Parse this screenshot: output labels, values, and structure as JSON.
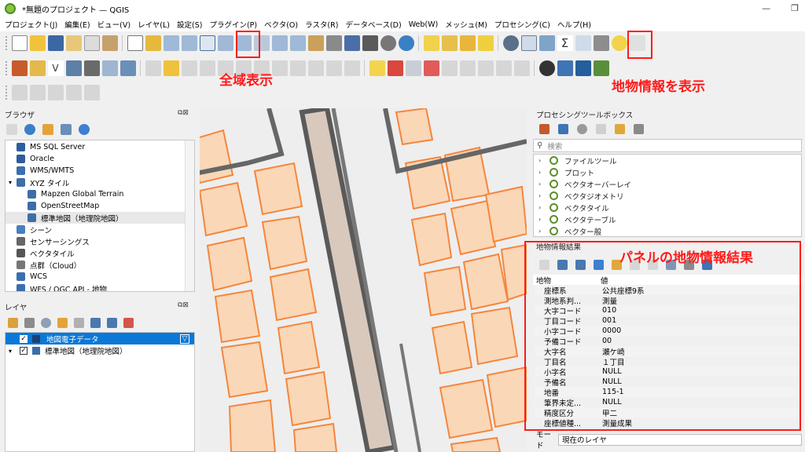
{
  "window": {
    "title": "*無題のプロジェクト — QGIS",
    "min": "—",
    "max": "❐"
  },
  "menu": [
    "プロジェクト(J)",
    "編集(E)",
    "ビュー(V)",
    "レイヤ(L)",
    "設定(S)",
    "プラグイン(P)",
    "ベクタ(O)",
    "ラスタ(R)",
    "データベース(D)",
    "Web(W)",
    "メッシュ(M)",
    "プロセシング(C)",
    "ヘルプ(H)"
  ],
  "annotations": {
    "zoom_full": "全域表示",
    "identify": "地物情報を表示",
    "panel_result": "パネルの地物情報結果"
  },
  "browser": {
    "title": "ブラウザ",
    "items": [
      {
        "label": "MS SQL Server",
        "indent": 1,
        "color": "#2d5d9c"
      },
      {
        "label": "Oracle",
        "indent": 1,
        "color": "#2d5d9c"
      },
      {
        "label": "WMS/WMTS",
        "indent": 1,
        "color": "#3a6fb0"
      },
      {
        "label": "XYZ タイル",
        "indent": 0,
        "color": "#3d6ea8"
      },
      {
        "label": "Mapzen Global Terrain",
        "indent": 2,
        "color": "#3d6ea8"
      },
      {
        "label": "OpenStreetMap",
        "indent": 2,
        "color": "#3d6ea8"
      },
      {
        "label": "標準地図（地理院地図）",
        "indent": 2,
        "color": "#3d6ea8"
      },
      {
        "label": "シーン",
        "indent": 1,
        "color": "#4a7fc0"
      },
      {
        "label": "センサーシングス",
        "indent": 1,
        "color": "#666666"
      },
      {
        "label": "ベクタタイル",
        "indent": 1,
        "color": "#555555"
      },
      {
        "label": "点群（Cloud）",
        "indent": 1,
        "color": "#777777"
      },
      {
        "label": "WCS",
        "indent": 1,
        "color": "#3a6fb0"
      },
      {
        "label": "WFS / OGC API - 地物",
        "indent": 1,
        "color": "#3a6fb0"
      }
    ]
  },
  "layers": {
    "title": "レイヤ",
    "items": [
      {
        "label": "地図電子データ",
        "selected": true
      },
      {
        "label": "標準地図（地理院地図）",
        "selected": false
      }
    ]
  },
  "processing": {
    "title": "プロセシングツールボックス",
    "search_placeholder": "検索",
    "groups": [
      "ファイルツール",
      "プロット",
      "ベクタオーバーレイ",
      "ベクタジオメトリ",
      "ベクタタイル",
      "ベクタテーブル",
      "ベクター般"
    ]
  },
  "identify": {
    "title": "地物情報結果",
    "col_feature": "地物",
    "col_value": "値",
    "rows": [
      {
        "k": "座標系",
        "v": "公共座標9系"
      },
      {
        "k": "測地系判...",
        "v": "測量"
      },
      {
        "k": "大字コード",
        "v": "010"
      },
      {
        "k": "丁目コード",
        "v": "001"
      },
      {
        "k": "小字コード",
        "v": "0000"
      },
      {
        "k": "予備コード",
        "v": "00"
      },
      {
        "k": "大字名",
        "v": "瀬ケ崎"
      },
      {
        "k": "丁目名",
        "v": "１丁目"
      },
      {
        "k": "小字名",
        "v": "NULL"
      },
      {
        "k": "予備名",
        "v": "NULL"
      },
      {
        "k": "地番",
        "v": "115-1"
      },
      {
        "k": "筆界未定...",
        "v": "NULL"
      },
      {
        "k": "精度区分",
        "v": "甲二"
      },
      {
        "k": "座標値種...",
        "v": "測量成果"
      }
    ],
    "mode_label": "モード",
    "mode_value": "現在のレイヤ"
  }
}
